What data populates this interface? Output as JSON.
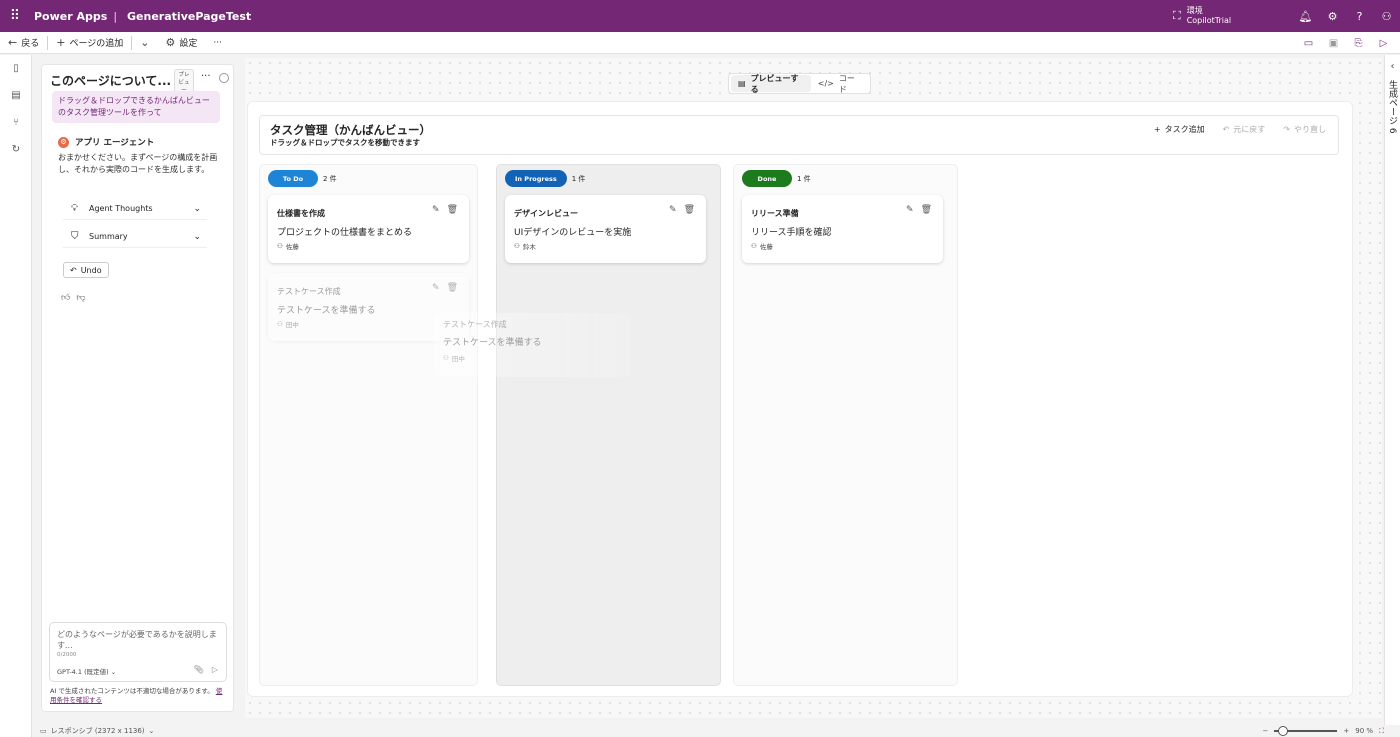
{
  "topbar": {
    "app_name": "Power Apps",
    "separator": "|",
    "page_name": "GenerativePageTest",
    "environment_label": "環境",
    "environment_name": "CopilotTrial",
    "icons": [
      "bell-icon",
      "gear-icon",
      "help-icon",
      "user-icon"
    ]
  },
  "commandbar": {
    "back_label": "戻る",
    "add_page_label": "ページの追加",
    "settings_label": "設定",
    "more_label": "···"
  },
  "agent_panel": {
    "title": "このページについて...",
    "preview_badge": "プレビュー",
    "user_prompt": "ドラッグ＆ドロップできるかんばんビューのタスク管理ツールを作って",
    "agent_name": "アプリ エージェント",
    "agent_message": "おまかせください。まずページの構成を計画し、それから実際のコードを生成します。",
    "agent_thoughts_label": "Agent Thoughts",
    "summary_label": "Summary",
    "undo_label": "Undo",
    "input_placeholder": "どのようなページが必要であるかを説明します...",
    "char_count": "0/2000",
    "model_label": "GPT-4.1 (既定値) ⌄",
    "disclaimer": "AI で生成されたコンテンツは不適切な場合があります。",
    "terms_link": "使用条件を確認する"
  },
  "view_toggle": {
    "preview_label": "プレビューする",
    "code_label": "コード"
  },
  "board": {
    "title": "タスク管理（かんばんビュー）",
    "subtitle": "ドラッグ＆ドロップでタスクを移動できます",
    "add_task_label": "タスク追加",
    "undo_label": "元に戻す",
    "redo_label": "やり直し"
  },
  "columns": {
    "todo": {
      "label": "To Do",
      "count": "2 件",
      "color": "#1e84d6"
    },
    "in_progress": {
      "label": "In Progress",
      "count": "1 件",
      "color": "#1262b5"
    },
    "done": {
      "label": "Done",
      "count": "1 件",
      "color": "#1d7a1d"
    }
  },
  "cards": {
    "todo_1": {
      "title": "仕様書を作成",
      "description": "プロジェクトの仕様書をまとめる",
      "assignee": "佐藤"
    },
    "todo_2": {
      "title": "テストケース作成",
      "description": "テストケースを準備する",
      "assignee": "田中"
    },
    "prog_1": {
      "title": "デザインレビュー",
      "description": "UIデザインのレビューを実施",
      "assignee": "鈴木"
    },
    "done_1": {
      "title": "リリース準備",
      "description": "リリース手順を確認",
      "assignee": "佐藤"
    },
    "drag_preview": {
      "title": "テストケース作成",
      "description": "テストケースを準備する",
      "assignee": "田中"
    }
  },
  "right_rail": {
    "label": "生成ページ 6"
  },
  "statusbar": {
    "responsive_label": "レスポンシブ (2372 x 1136)",
    "zoom_label": "90 %",
    "zoom_value": 0.14
  }
}
